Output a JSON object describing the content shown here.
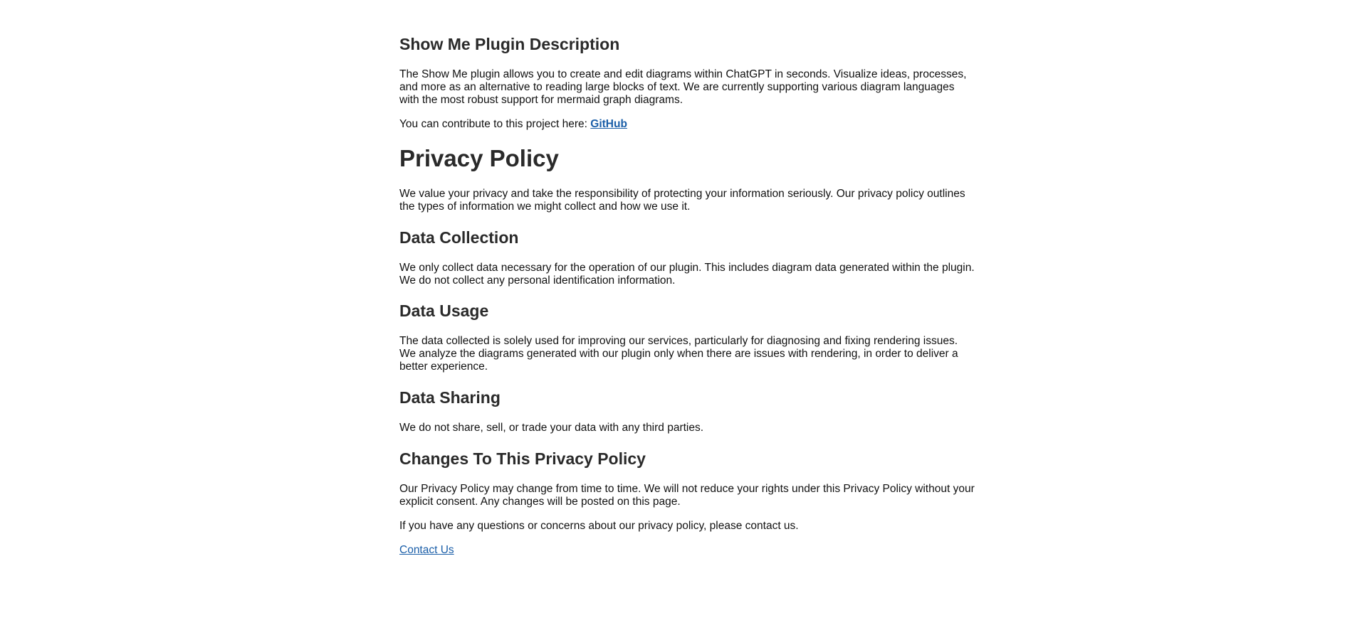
{
  "plugin": {
    "title": "Show Me Plugin Description",
    "description": "The Show Me plugin allows you to create and edit diagrams within ChatGPT in seconds. Visualize ideas, processes, and more as an alternative to reading large blocks of text. We are currently supporting various diagram languages with the most robust support for mermaid graph diagrams.",
    "contribute_text": "You can contribute to this project here:",
    "github_link": "GitHub"
  },
  "privacy": {
    "title": "Privacy Policy",
    "intro": "We value your privacy and take the responsibility of protecting your information seriously. Our privacy policy outlines the types of information we might collect and how we use it.",
    "sections": [
      {
        "heading": "Data Collection",
        "body": "We only collect data necessary for the operation of our plugin. This includes diagram data generated within the plugin. We do not collect any personal identification information."
      },
      {
        "heading": "Data Usage",
        "body": "The data collected is solely used for improving our services, particularly for diagnosing and fixing rendering issues. We analyze the diagrams generated with our plugin only when there are issues with rendering, in order to deliver a better experience."
      },
      {
        "heading": "Data Sharing",
        "body": "We do not share, sell, or trade your data with any third parties."
      },
      {
        "heading": "Changes To This Privacy Policy",
        "body": "Our Privacy Policy may change from time to time. We will not reduce your rights under this Privacy Policy without your explicit consent. Any changes will be posted on this page."
      }
    ],
    "questions_text": "If you have any questions or concerns about our privacy policy, please contact us.",
    "contact_link": "Contact Us"
  },
  "colors": {
    "link": "#1a5ea8",
    "heading": "#2a2a2a",
    "text": "#111111",
    "background": "#ffffff"
  }
}
